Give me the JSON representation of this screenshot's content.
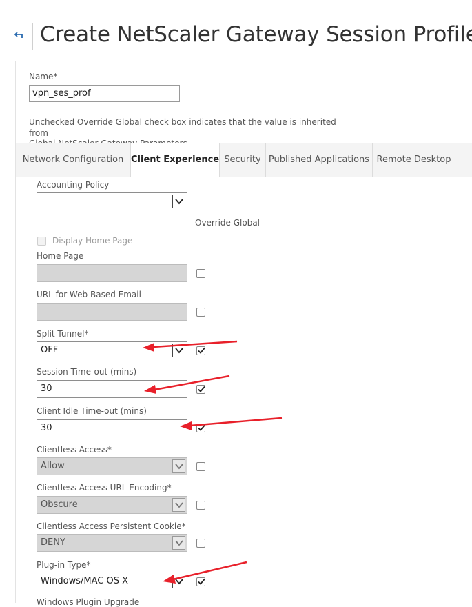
{
  "page": {
    "title": "Create NetScaler Gateway Session Profile"
  },
  "name_field": {
    "label": "Name*",
    "value": "vpn_ses_prof"
  },
  "info_text": {
    "line1": "Unchecked Override Global check box indicates that the value is inherited from",
    "line2": "Global NetScaler Gateway Parameters."
  },
  "tabs": [
    {
      "label": "Network Configuration",
      "active": false
    },
    {
      "label": "Client Experience",
      "active": true
    },
    {
      "label": "Security",
      "active": false
    },
    {
      "label": "Published Applications",
      "active": false
    },
    {
      "label": "Remote Desktop",
      "active": false
    }
  ],
  "form": {
    "accounting_policy": {
      "label": "Accounting Policy",
      "value": ""
    },
    "override_global_header": "Override Global",
    "display_home_page": {
      "label": "Display Home Page",
      "checked": false
    },
    "home_page": {
      "label": "Home Page",
      "value": "",
      "override": false
    },
    "url_web_email": {
      "label": "URL for Web-Based Email",
      "value": "",
      "override": false
    },
    "split_tunnel": {
      "label": "Split Tunnel*",
      "value": "OFF",
      "override": true
    },
    "session_timeout": {
      "label": "Session Time-out (mins)",
      "value": "30",
      "override": true
    },
    "client_idle_timeout": {
      "label": "Client Idle Time-out (mins)",
      "value": "30",
      "override": true
    },
    "clientless_access": {
      "label": "Clientless Access*",
      "value": "Allow",
      "override": false
    },
    "clientless_url_encoding": {
      "label": "Clientless Access URL Encoding*",
      "value": "Obscure",
      "override": false
    },
    "clientless_persistent_cookie": {
      "label": "Clientless Access Persistent Cookie*",
      "value": "DENY",
      "override": false
    },
    "plugin_type": {
      "label": "Plug-in Type*",
      "value": "Windows/MAC OS X",
      "override": true
    },
    "windows_plugin_upgrade": {
      "label": "Windows Plugin Upgrade"
    }
  },
  "colors": {
    "accent": "#2b6cb0",
    "annotation_red": "#e8202a"
  }
}
